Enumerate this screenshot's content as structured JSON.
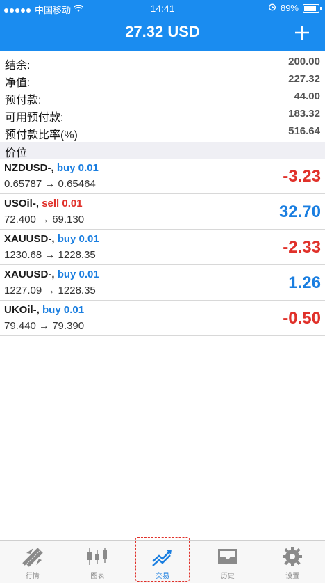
{
  "status": {
    "carrier": "中国移动",
    "time": "14:41",
    "battery": "89%"
  },
  "header": {
    "title": "27.32 USD"
  },
  "summary": [
    {
      "label": "结余:",
      "value": "200.00"
    },
    {
      "label": "净值:",
      "value": "227.32"
    },
    {
      "label": "预付款:",
      "value": "44.00"
    },
    {
      "label": "可用预付款:",
      "value": "183.32"
    },
    {
      "label": "预付款比率(%)",
      "value": "516.64"
    }
  ],
  "section_title": "价位",
  "positions": [
    {
      "symbol": "NZDUSD-,",
      "side": "buy 0.01",
      "prices": "0.65787 → 0.65464",
      "pl": "-3.23"
    },
    {
      "symbol": "USOil-,",
      "side": "sell 0.01",
      "prices": "72.400 → 69.130",
      "pl": "32.70"
    },
    {
      "symbol": "XAUUSD-,",
      "side": "buy 0.01",
      "prices": "1230.68 → 1228.35",
      "pl": "-2.33"
    },
    {
      "symbol": "XAUUSD-,",
      "side": "buy 0.01",
      "prices": "1227.09 → 1228.35",
      "pl": "1.26"
    },
    {
      "symbol": "UKOil-,",
      "side": "buy 0.01",
      "prices": "79.440 → 79.390",
      "pl": "-0.50"
    }
  ],
  "tabs": [
    {
      "label": "行情",
      "icon": "quotes-icon"
    },
    {
      "label": "图表",
      "icon": "chart-icon"
    },
    {
      "label": "交易",
      "icon": "trade-icon"
    },
    {
      "label": "历史",
      "icon": "history-icon"
    },
    {
      "label": "设置",
      "icon": "settings-icon"
    }
  ],
  "colors": {
    "accent": "#1a8cf0",
    "profit": "#1a7ee0",
    "loss": "#e0312a"
  }
}
